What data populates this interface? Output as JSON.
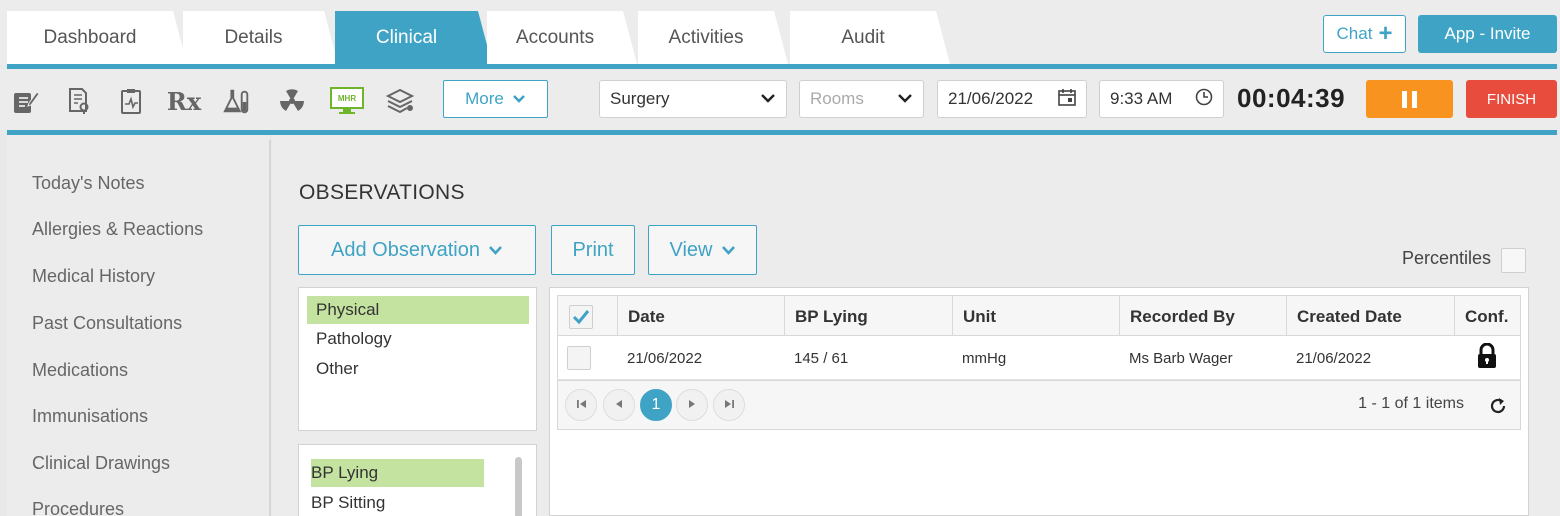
{
  "tabs": [
    {
      "label": "Dashboard"
    },
    {
      "label": "Details"
    },
    {
      "label": "Clinical"
    },
    {
      "label": "Accounts"
    },
    {
      "label": "Activities"
    },
    {
      "label": "Audit"
    }
  ],
  "header": {
    "chat_label": "Chat",
    "chat_plus": "+",
    "invite_label": "App - Invite"
  },
  "toolbar": {
    "icons": [
      "notes-icon",
      "referral-icon",
      "results-icon",
      "prescription-icon",
      "lab-icon",
      "radiation-icon",
      "mhr-icon",
      "education-icon"
    ],
    "mhr_text": "MHR",
    "rx_text": "Rx",
    "more_label": "More",
    "location": "Surgery",
    "rooms_placeholder": "Rooms",
    "date": "21/06/2022",
    "time": "9:33 AM",
    "timer": "00:04:39",
    "finish_label": "FINISH",
    "accent": "#3fa3c5",
    "pause_color": "#f7931e",
    "finish_color": "#e84c3d"
  },
  "sidebar": {
    "items": [
      {
        "label": "Today's Notes"
      },
      {
        "label": "Allergies & Reactions"
      },
      {
        "label": "Medical History"
      },
      {
        "label": "Past Consultations"
      },
      {
        "label": "Medications"
      },
      {
        "label": "Immunisations"
      },
      {
        "label": "Clinical Drawings"
      },
      {
        "label": "Procedures"
      }
    ]
  },
  "observations": {
    "title": "OBSERVATIONS",
    "add_label": "Add Observation",
    "print_label": "Print",
    "view_label": "View",
    "percentiles_label": "Percentiles",
    "categories": [
      {
        "label": "Physical",
        "selected": true
      },
      {
        "label": "Pathology",
        "selected": false
      },
      {
        "label": "Other",
        "selected": false
      }
    ],
    "subtypes": [
      {
        "label": "BP Lying",
        "selected": true
      },
      {
        "label": "BP Sitting",
        "selected": false
      }
    ],
    "grid": {
      "columns": [
        "Date",
        "BP Lying",
        "Unit",
        "Recorded By",
        "Created Date",
        "Conf."
      ],
      "rows": [
        {
          "date": "21/06/2022",
          "value": "145 / 61",
          "unit": "mmHg",
          "recorded_by": "Ms Barb Wager",
          "created": "21/06/2022",
          "confidential": true
        }
      ],
      "current_page": "1",
      "page_info": "1 - 1 of 1 items"
    }
  }
}
